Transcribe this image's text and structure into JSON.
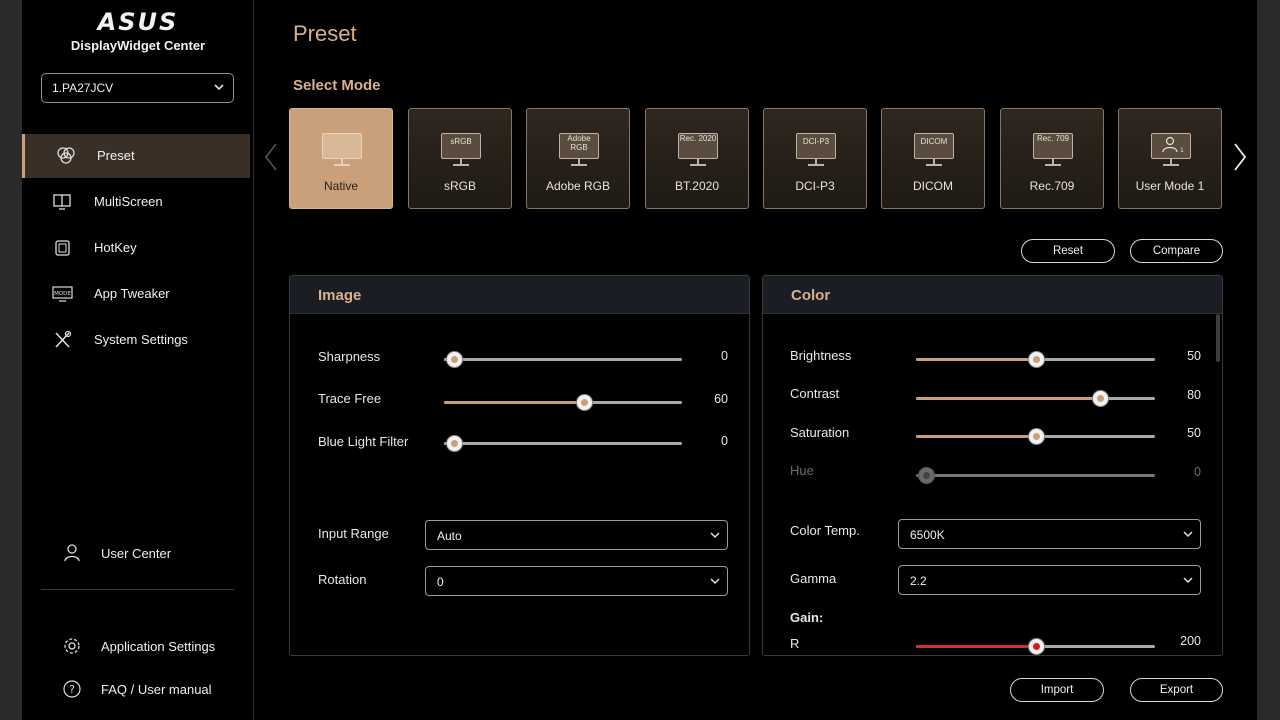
{
  "app": {
    "brand": "ASUS",
    "name": "DisplayWidget Center"
  },
  "monitor_select": {
    "value": "1.PA27JCV"
  },
  "sidebar": {
    "items": [
      {
        "label": "Preset",
        "icon": "preset-icon",
        "active": true
      },
      {
        "label": "MultiScreen",
        "icon": "multiscreen-icon",
        "active": false
      },
      {
        "label": "HotKey",
        "icon": "hotkey-icon",
        "active": false
      },
      {
        "label": "App Tweaker",
        "icon": "mode-icon",
        "active": false
      },
      {
        "label": "System Settings",
        "icon": "tools-icon",
        "active": false
      }
    ],
    "user_center": "User Center",
    "app_settings": "Application Settings",
    "faq": "FAQ / User manual"
  },
  "page": {
    "title": "Preset",
    "select_mode_label": "Select Mode"
  },
  "modes": [
    {
      "label": "Native",
      "screen_text": "",
      "active": true
    },
    {
      "label": "sRGB",
      "screen_text": "sRGB",
      "active": false
    },
    {
      "label": "Adobe RGB",
      "screen_text": "Adobe RGB",
      "active": false
    },
    {
      "label": "BT.2020",
      "screen_text": "Rec. 2020",
      "active": false
    },
    {
      "label": "DCI-P3",
      "screen_text": "DCI-P3",
      "active": false
    },
    {
      "label": "DICOM",
      "screen_text": "DICOM",
      "active": false
    },
    {
      "label": "Rec.709",
      "screen_text": "Rec. 709",
      "active": false
    },
    {
      "label": "User Mode 1",
      "screen_text": "",
      "active": false
    }
  ],
  "actions": {
    "reset": "Reset",
    "compare": "Compare",
    "import": "Import",
    "export": "Export"
  },
  "image_panel": {
    "title": "Image",
    "sliders": [
      {
        "label": "Sharpness",
        "value": "0",
        "fraction": 0.04
      },
      {
        "label": "Trace Free",
        "value": "60",
        "fraction": 0.59
      },
      {
        "label": "Blue Light Filter",
        "value": "0",
        "fraction": 0.04
      }
    ],
    "input_range": {
      "label": "Input Range",
      "value": "Auto"
    },
    "rotation": {
      "label": "Rotation",
      "value": "0"
    }
  },
  "color_panel": {
    "title": "Color",
    "sliders": [
      {
        "label": "Brightness",
        "value": "50",
        "fraction": 0.5
      },
      {
        "label": "Contrast",
        "value": "80",
        "fraction": 0.77
      },
      {
        "label": "Saturation",
        "value": "50",
        "fraction": 0.5
      },
      {
        "label": "Hue",
        "value": "0",
        "fraction": 0.04,
        "disabled": true
      }
    ],
    "color_temp": {
      "label": "Color Temp.",
      "value": "6500K"
    },
    "gamma": {
      "label": "Gamma",
      "value": "2.2"
    },
    "gain": {
      "label": "Gain:",
      "r_label": "R",
      "r_value": "200",
      "r_fraction": 0.5
    }
  }
}
